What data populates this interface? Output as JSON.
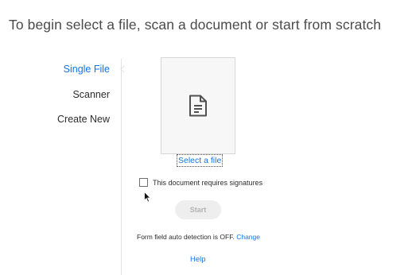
{
  "header": {
    "title": "To begin select a file, scan a document or start from scratch"
  },
  "nav": {
    "items": [
      {
        "label": "Single File",
        "active": true
      },
      {
        "label": "Scanner",
        "active": false
      },
      {
        "label": "Create New",
        "active": false
      }
    ]
  },
  "file_picker": {
    "icon": "document-icon",
    "select_label": "Select a file"
  },
  "signatures": {
    "label": "This document requires signatures",
    "checked": false
  },
  "start_button": {
    "label": "Start",
    "enabled": false
  },
  "form_detection": {
    "status_text": "Form field auto detection is OFF.",
    "change_label": "Change"
  },
  "help": {
    "label": "Help"
  },
  "colors": {
    "accent": "#1473e6",
    "text": "#2c2c2c",
    "disabled_bg": "#eeeeee",
    "disabled_text": "#b3b3b3"
  }
}
